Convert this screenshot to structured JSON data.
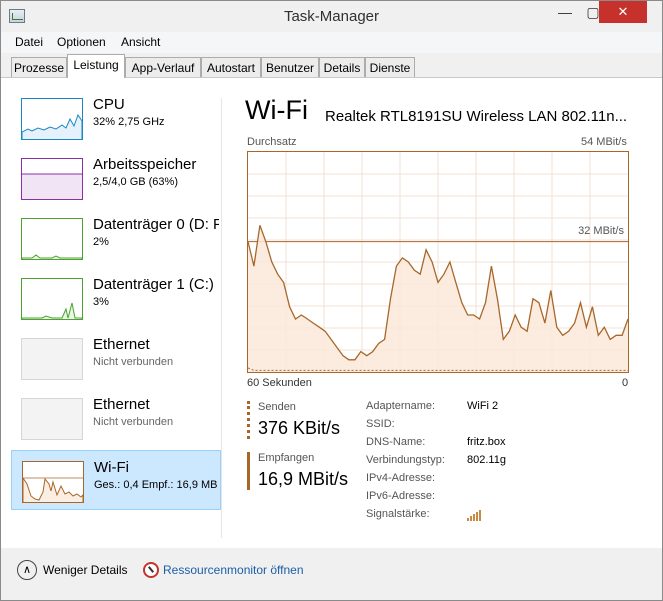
{
  "window": {
    "title": "Task-Manager",
    "minimize": "—",
    "maximize": "▢",
    "close": "✕"
  },
  "menu": [
    "Datei",
    "Optionen",
    "Ansicht"
  ],
  "tabs": [
    "Prozesse",
    "Leistung",
    "App-Verlauf",
    "Autostart",
    "Benutzer",
    "Details",
    "Dienste"
  ],
  "active_tab": "Leistung",
  "sidebar": [
    {
      "name": "CPU",
      "sub": "32% 2,75 GHz",
      "color": "#1a86c3"
    },
    {
      "name": "Arbeitsspeicher",
      "sub": "2,5/4,0 GB (63%)",
      "color": "#8b2fa8"
    },
    {
      "name": "Datenträger 0 (D: F",
      "sub": "2%",
      "color": "#4da32f"
    },
    {
      "name": "Datenträger 1 (C:)",
      "sub": "3%",
      "color": "#4da32f"
    },
    {
      "name": "Ethernet",
      "sub": "Nicht verbunden",
      "color": "#a7672b"
    },
    {
      "name": "Ethernet",
      "sub": "Nicht verbunden",
      "color": "#a7672b"
    },
    {
      "name": "Wi-Fi",
      "sub": "Ges.: 0,4 Empf.: 16,9 MB",
      "color": "#a7672b"
    }
  ],
  "main": {
    "title": "Wi-Fi",
    "adapter": "Realtek RTL8191SU Wireless LAN 802.11n...",
    "throughput_label": "Durchsatz",
    "max_label": "54 MBit/s",
    "mid_label": "32 MBit/s",
    "axis_left": "60 Sekunden",
    "axis_right": "0",
    "sent_label": "Senden",
    "sent_value": "376 KBit/s",
    "recv_label": "Empfangen",
    "recv_value": "16,9 MBit/s",
    "details": [
      {
        "key": "Adaptername:",
        "value": "WiFi 2"
      },
      {
        "key": "SSID:",
        "value": ""
      },
      {
        "key": "DNS-Name:",
        "value": "fritz.box"
      },
      {
        "key": "Verbindungstyp:",
        "value": "802.11g"
      },
      {
        "key": "IPv4-Adresse:",
        "value": ""
      },
      {
        "key": "IPv6-Adresse:",
        "value": ""
      },
      {
        "key": "Signalstärke:",
        "value": ""
      }
    ]
  },
  "footer": {
    "fewer": "Weniger Details",
    "resmon": "Ressourcenmonitor öffnen"
  },
  "chart_data": {
    "type": "area",
    "ylim": [
      0,
      54
    ],
    "units": "MBit/s",
    "receive": [
      32,
      26,
      36,
      32,
      27,
      24,
      22,
      16,
      13,
      14,
      13,
      12,
      11,
      10,
      8,
      6,
      4,
      3,
      3,
      5,
      4,
      5,
      7,
      8,
      18,
      26,
      28,
      27,
      25,
      24,
      30,
      27,
      22,
      24,
      27,
      22,
      17,
      14,
      14,
      13,
      17,
      26,
      18,
      8,
      10,
      14,
      11,
      10,
      18,
      17,
      12,
      20,
      11,
      9,
      10,
      12,
      17,
      11,
      16,
      9,
      11,
      8,
      9,
      9,
      13
    ],
    "send": [
      1,
      0.4,
      0.4,
      0.4,
      0.4,
      0.4,
      0.4,
      0.4,
      0.4,
      0.4,
      0.4,
      0.4,
      0.4,
      0.4,
      0.4,
      0.4,
      0.4,
      0.4,
      0.4,
      0.4,
      0.4,
      0.4,
      0.4,
      0.4,
      0.4,
      0.4,
      0.4,
      0.4,
      0.4,
      0.4,
      0.4,
      0.4,
      0.4,
      0.4,
      0.4,
      0.4,
      0.4,
      0.4,
      0.4,
      0.4,
      0.4,
      0.4,
      0.4,
      0.4,
      0.4,
      0.4,
      0.4,
      0.4,
      0.4,
      0.4,
      0.4,
      0.4,
      0.4,
      0.4,
      0.4,
      0.4,
      0.4,
      0.4,
      0.4,
      0.4,
      0.4,
      0.4,
      0.4,
      0.4,
      0.4
    ]
  }
}
